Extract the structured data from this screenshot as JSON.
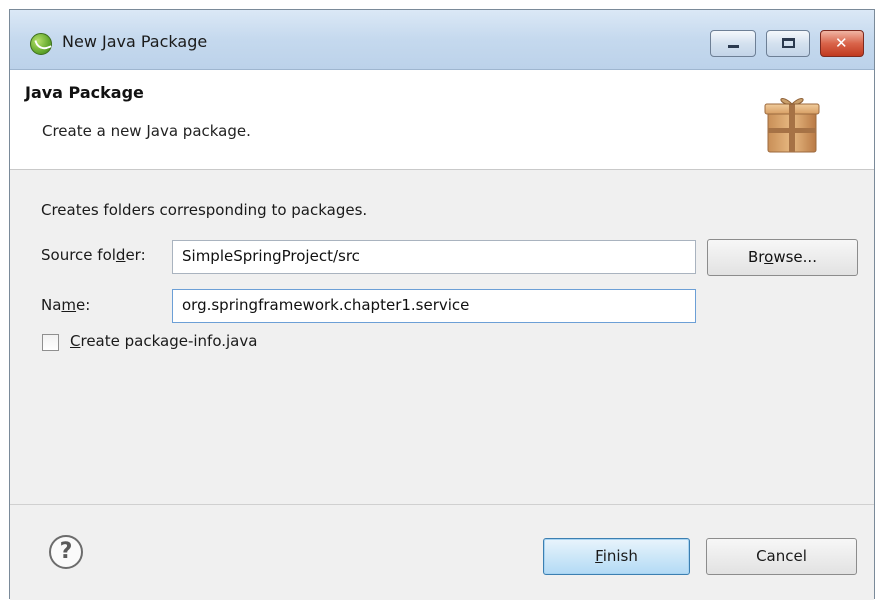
{
  "window": {
    "title": "New Java Package"
  },
  "banner": {
    "title": "Java Package",
    "description": "Create a new Java package.",
    "icon": "package-icon"
  },
  "form": {
    "info": "Creates folders corresponding to packages.",
    "source_folder": {
      "label_pre": "Source fol",
      "label_mnemonic": "d",
      "label_post": "er:",
      "value": "SimpleSpringProject/src"
    },
    "name": {
      "label_pre": "Na",
      "label_mnemonic": "m",
      "label_post": "e:",
      "value": "org.springframework.chapter1.service"
    },
    "browse": {
      "label_pre": "Br",
      "label_mnemonic": "o",
      "label_post": "wse..."
    },
    "create_package_info": {
      "label_mnemonic": "C",
      "label_post": "reate package-info.java",
      "checked": false
    }
  },
  "footer": {
    "help": "?",
    "finish": {
      "label_mnemonic": "F",
      "label_post": "inish"
    },
    "cancel": "Cancel"
  },
  "colors": {
    "titlebar": "#c5d9ee",
    "close_button": "#c0391f",
    "default_button": "#b3daf5"
  }
}
